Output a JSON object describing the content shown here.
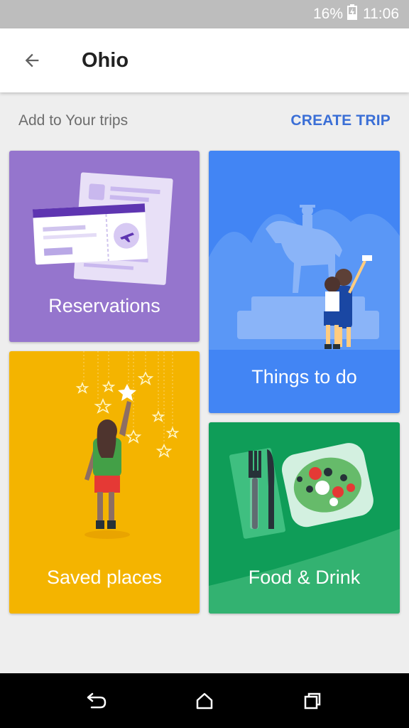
{
  "status_bar": {
    "battery": "16%",
    "time": "11:06",
    "icons": [
      "battery-charging-icon"
    ]
  },
  "app_bar": {
    "back_icon": "arrow-back-icon",
    "title": "Ohio"
  },
  "section": {
    "label": "Add to Your trips",
    "action": "CREATE TRIP"
  },
  "cards": {
    "reservations": {
      "label": "Reservations",
      "color": "#9575cd"
    },
    "saved_places": {
      "label": "Saved places",
      "color": "#f4b400"
    },
    "things_to_do": {
      "label": "Things to do",
      "color": "#4285f4"
    },
    "food_drink": {
      "label": "Food & Drink",
      "color": "#0f9d58"
    }
  },
  "nav_bar": {
    "icons": [
      "back-nav-icon",
      "home-nav-icon",
      "recents-nav-icon"
    ]
  }
}
